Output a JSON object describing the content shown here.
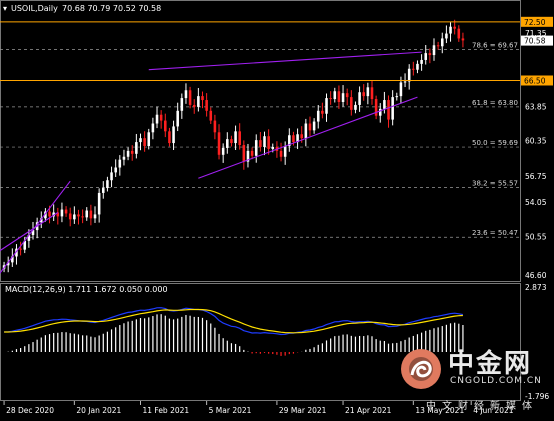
{
  "header": {
    "symbol": "USOIL,Daily",
    "ohlc": "70.68 70.79 70.52 70.58",
    "macd_label": "MACD(12,26,9) 1.711 1.672 0.050 0.000"
  },
  "colors": {
    "background": "#000000",
    "bull": "#ffffff",
    "bear": "#ff2020",
    "channel": "#a020f0",
    "level": "#ffa500",
    "fib": "#9a9a9a",
    "macd_line": "#1e3cff",
    "signal_line": "#ffe000",
    "macd_pos_hist": "#ffffff",
    "macd_neg_hist": "#ff2020"
  },
  "price_axis": [
    "72.50",
    "71.35",
    "70.58",
    "66.50",
    "63.85",
    "60.35",
    "56.75",
    "54.05",
    "50.55",
    "46.60"
  ],
  "level_tags": [
    {
      "value": "72.50",
      "style": "orange"
    },
    {
      "value": "70.58",
      "style": "white"
    },
    {
      "value": "66.50",
      "style": "orange"
    }
  ],
  "macd_axis": [
    "2.873",
    "-1.796"
  ],
  "fib_levels": [
    {
      "label": "78.6 = 69.67",
      "price": 69.67
    },
    {
      "label": "61.8 = 63.80",
      "price": 63.8
    },
    {
      "label": "50.0 = 59.69",
      "price": 59.69
    },
    {
      "label": "38.2 = 55.57",
      "price": 55.57
    },
    {
      "label": "23.6 = 50.47",
      "price": 50.47
    }
  ],
  "date_axis": [
    "28 Dec 2020",
    "20 Jan 2021",
    "11 Feb 2021",
    "5 Mar 2021",
    "29 Mar 2021",
    "21 Apr 2021",
    "13 May 2021",
    "4 Jun 2021"
  ],
  "watermark": {
    "icon": "dragon-logo-icon",
    "brand": "中金网",
    "url": "CNGOLD.COM.CN",
    "sub": "中文财经新媒体"
  },
  "chart_data": {
    "type": "candlestick",
    "symbol": "USOIL",
    "timeframe": "Daily",
    "ylim": [
      46.3,
      73.3
    ],
    "horizontal_levels": [
      72.5,
      66.5
    ],
    "candles_close": [
      47.6,
      47.9,
      48.5,
      49.3,
      49.2,
      50.1,
      50.7,
      51.2,
      52.0,
      52.4,
      53.1,
      52.6,
      53.0,
      52.6,
      53.3,
      52.9,
      52.3,
      52.8,
      52.6,
      52.5,
      53.2,
      52.4,
      52.8,
      55.0,
      55.5,
      56.3,
      57.1,
      57.6,
      58.4,
      58.7,
      59.3,
      59.0,
      60.2,
      60.6,
      59.8,
      61.2,
      62.1,
      63.0,
      62.4,
      61.3,
      60.1,
      61.8,
      63.4,
      64.7,
      65.5,
      64.0,
      63.8,
      64.9,
      64.5,
      63.4,
      62.4,
      61.2,
      58.9,
      59.6,
      60.5,
      60.1,
      61.3,
      59.9,
      58.2,
      59.3,
      58.8,
      60.4,
      59.7,
      60.8,
      59.5,
      59.7,
      59.3,
      58.7,
      59.8,
      60.9,
      60.2,
      61.0,
      60.6,
      62.1,
      61.4,
      62.3,
      63.4,
      63.1,
      64.7,
      64.6,
      65.4,
      64.3,
      65.2,
      64.8,
      63.5,
      64.0,
      65.3,
      64.9,
      65.8,
      64.6,
      62.9,
      63.6,
      64.5,
      62.5,
      64.8,
      64.9,
      66.3,
      66.4,
      67.7,
      67.6,
      68.2,
      68.6,
      69.3,
      69.1,
      70.1,
      70.0,
      70.8,
      71.3,
      72.0,
      71.8,
      70.8,
      70.6
    ],
    "macd_levels": [
      "2.873",
      "-1.796"
    ]
  }
}
